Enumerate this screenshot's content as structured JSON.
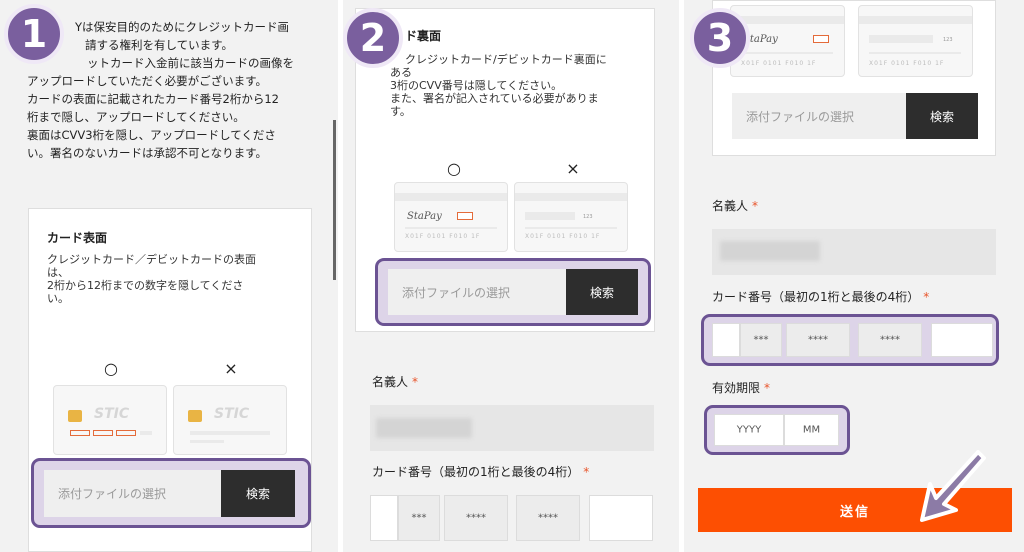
{
  "steps": [
    "1",
    "2",
    "3"
  ],
  "intro": {
    "lines": [
      "Yは保安目的のためにクレジットカード画",
      "請する権利を有しています。",
      "ットカード入金前に該当カードの画像を",
      "アップロードしていただく必要がございます。",
      "カードの表面に記載されたカード番号2桁から12",
      "桁まで隠し、アップロードしてください。",
      "裏面はCVV3桁を隠し、アップロードしてくださ",
      "い。署名のないカードは承認不可となります。"
    ]
  },
  "front_card": {
    "title": "カード表面",
    "desc": [
      "クレジットカード／デビットカードの表面",
      "は、",
      "2桁から12桁までの数字を隠してくださ",
      "い。"
    ],
    "ok_mark": "○",
    "ng_mark": "×",
    "brand": "STIC"
  },
  "back_card": {
    "title": "ド裏面",
    "desc": [
      "クレジットカード/デビットカード裏面に",
      "ある",
      "3桁のCVV番号は隠してください。",
      "また、署名が記入されている必要がありま",
      "す。"
    ],
    "ok_mark": "○",
    "ng_mark": "×",
    "cvv": "123"
  },
  "upload": {
    "placeholder": "添付ファイルの選択",
    "button": "検索"
  },
  "form": {
    "name_label": "名義人",
    "card_number_label": "カード番号（最初の1桁と最後の4桁）",
    "expiry_label": "有効期限",
    "mask3": "***",
    "mask4": "****",
    "year_placeholder": "YYYY",
    "month_placeholder": "MM",
    "submit": "送信"
  },
  "colors": {
    "accent": "#fd4f02",
    "highlight_frame": "#6b5393",
    "badge": "#7a5f9e",
    "required": "#e8542a",
    "dark_button": "#2d2d2d"
  }
}
